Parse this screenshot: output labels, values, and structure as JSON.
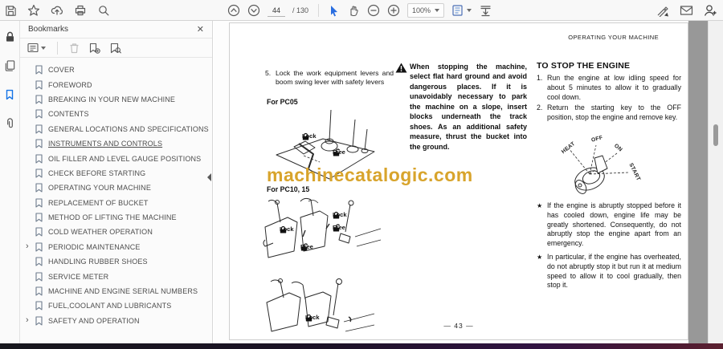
{
  "toolbar": {
    "page_current": "44",
    "page_total_label": "/ 130",
    "zoom_value": "100%"
  },
  "icons": {
    "close": "✕",
    "chevron_expand": "›"
  },
  "bookmarks_panel": {
    "title": "Bookmarks",
    "items": [
      {
        "label": "COVER",
        "expandable": false,
        "selected": false
      },
      {
        "label": "FOREWORD",
        "expandable": false,
        "selected": false
      },
      {
        "label": "BREAKING IN YOUR NEW MACHINE",
        "expandable": false,
        "selected": false
      },
      {
        "label": "CONTENTS",
        "expandable": false,
        "selected": false
      },
      {
        "label": "GENERAL LOCATIONS AND SPECIFICATIONS",
        "expandable": false,
        "selected": false
      },
      {
        "label": "INSTRUMENTS AND CONTROLS",
        "expandable": false,
        "selected": true
      },
      {
        "label": "OIL FILLER AND LEVEL GAUGE POSITIONS",
        "expandable": false,
        "selected": false
      },
      {
        "label": "CHECK BEFORE STARTING",
        "expandable": false,
        "selected": false
      },
      {
        "label": "OPERATING YOUR MACHINE",
        "expandable": false,
        "selected": false
      },
      {
        "label": "REPLACEMENT OF BUCKET",
        "expandable": false,
        "selected": false
      },
      {
        "label": "METHOD OF LIFTING THE MACHINE",
        "expandable": false,
        "selected": false
      },
      {
        "label": "COLD WEATHER OPERATION",
        "expandable": false,
        "selected": false
      },
      {
        "label": "PERIODIC MAINTENANCE",
        "expandable": true,
        "selected": false
      },
      {
        "label": "HANDLING RUBBER SHOES",
        "expandable": false,
        "selected": false
      },
      {
        "label": "SERVICE METER",
        "expandable": false,
        "selected": false
      },
      {
        "label": "MACHINE AND ENGINE SERIAL NUMBERS",
        "expandable": false,
        "selected": false
      },
      {
        "label": "FUEL,COOLANT AND LUBRICANTS",
        "expandable": false,
        "selected": false
      },
      {
        "label": "SAFETY AND OPERATION",
        "expandable": true,
        "selected": false
      }
    ]
  },
  "document": {
    "running_header": "OPERATING YOUR MACHINE",
    "watermark": "machinecatalogic.com",
    "page_number": "— 43 —",
    "labels": {
      "lock": "Lock",
      "free": "Free"
    },
    "left_column": {
      "step_number": "5.",
      "step_text": "Lock the work equipment levers and boom swing lever with safety levers",
      "for_pc05": "For PC05",
      "for_pc10_15": "For PC10, 15"
    },
    "middle_column": {
      "warning_text": "When stopping the machine, select flat hard ground and avoid dangerous places. If it is unavoidably necessary to park the machine on a slope, insert blocks underneath the track shoes. As an additional safety measure, thrust the bucket into the ground."
    },
    "right_column": {
      "heading": "TO STOP THE ENGINE",
      "step1_number": "1.",
      "step1_text": "Run the engine at low idling speed for about 5 minutes to allow it to gradually cool down.",
      "step2_number": "2.",
      "step2_text": "Return the starting key to the OFF position, stop the engine and remove key.",
      "key_positions": [
        "HEAT",
        "OFF",
        "ON",
        "START"
      ],
      "note_bullet": "★",
      "note1": "If the engine is abruptly stopped before it has cooled down, engine life may be greatly shortened. Consequently, do not abruptly stop the engine apart from an emergency.",
      "note2": "In particular, if the engine has overheated, do not abruptly stop it but run it at medium speed to allow it to cool gradually, then stop it."
    }
  }
}
